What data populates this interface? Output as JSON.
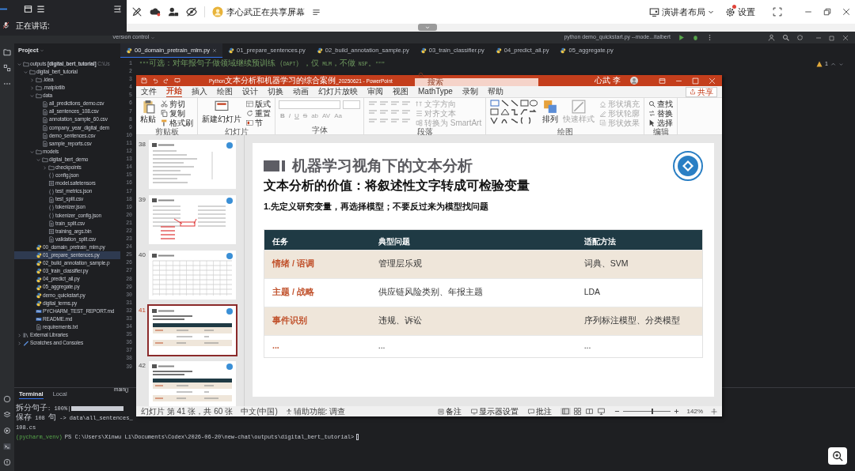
{
  "meeting": {
    "speaking_label": "正在讲话:",
    "share_status": "李心武正在共享屏幕",
    "layout_button": "演讲者布局",
    "settings_button": "设置",
    "settings_alert": true
  },
  "ide": {
    "vcs_menu": "Version control",
    "run_config": "python demo_quickstart.py --mode...italbert",
    "project_label": "Project",
    "editor_tabs": [
      {
        "label": "00_domain_pretrain_mlm.py",
        "selected": true
      },
      {
        "label": "01_prepare_sentences.py",
        "selected": false
      },
      {
        "label": "02_build_annotation_sample.py",
        "selected": false
      },
      {
        "label": "03_train_classifier.py",
        "selected": false
      },
      {
        "label": "04_predict_all.py",
        "selected": false
      },
      {
        "label": "05_aggregate.py",
        "selected": false
      }
    ],
    "tree": [
      {
        "label": "outputs **[digital_bert_tutorial]**",
        "hint": "C:\\Us",
        "kind": "folder",
        "expanded": true,
        "selected": false,
        "children": [
          {
            "label": "digital_bert_tutorial",
            "kind": "folder",
            "expanded": true,
            "selected": false,
            "children": [
              {
                "label": ".idea",
                "kind": "folder",
                "expanded": false,
                "selected": false
              },
              {
                "label": ".matplotlib",
                "kind": "folder",
                "expanded": false,
                "selected": false
              },
              {
                "label": "data",
                "kind": "folder",
                "expanded": true,
                "selected": false,
                "children": [
                  {
                    "label": "all_predictions_demo.csv",
                    "kind": "csv",
                    "selected": false
                  },
                  {
                    "label": "all_sentences_108.csv",
                    "kind": "csv",
                    "selected": false
                  },
                  {
                    "label": "annotation_sample_60.csv",
                    "kind": "csv",
                    "selected": false
                  },
                  {
                    "label": "company_year_digital_dem",
                    "kind": "csv",
                    "selected": false
                  },
                  {
                    "label": "demo_sentences.csv",
                    "kind": "csv",
                    "selected": false
                  },
                  {
                    "label": "sample_reports.csv",
                    "kind": "csv",
                    "selected": false
                  }
                ]
              },
              {
                "label": "models",
                "kind": "folder",
                "expanded": true,
                "selected": false,
                "children": [
                  {
                    "label": "digital_bert_demo",
                    "kind": "folder",
                    "expanded": true,
                    "selected": false,
                    "children": [
                      {
                        "label": "checkpoints",
                        "kind": "folder",
                        "expanded": false,
                        "selected": false
                      },
                      {
                        "label": "config.json",
                        "kind": "json",
                        "selected": false
                      },
                      {
                        "label": "model.safetensors",
                        "kind": "bin",
                        "selected": false
                      },
                      {
                        "label": "test_metrics.json",
                        "kind": "json",
                        "selected": false
                      },
                      {
                        "label": "test_split.csv",
                        "kind": "csv",
                        "selected": false
                      },
                      {
                        "label": "tokenizer.json",
                        "kind": "json",
                        "selected": false
                      },
                      {
                        "label": "tokenizer_config.json",
                        "kind": "json",
                        "selected": false
                      },
                      {
                        "label": "train_split.csv",
                        "kind": "csv",
                        "selected": false
                      },
                      {
                        "label": "training_args.bin",
                        "kind": "bin",
                        "selected": false
                      },
                      {
                        "label": "validation_split.csv",
                        "kind": "csv",
                        "selected": false
                      }
                    ]
                  }
                ]
              },
              {
                "label": "00_domain_pretrain_mlm.py",
                "kind": "py",
                "selected": false
              },
              {
                "label": "01_prepare_sentences.py",
                "kind": "py",
                "selected": true
              },
              {
                "label": "02_build_annotation_sample.p",
                "kind": "py",
                "selected": false
              },
              {
                "label": "03_train_classifier.py",
                "kind": "py",
                "selected": false
              },
              {
                "label": "04_predict_all.py",
                "kind": "py",
                "selected": false
              },
              {
                "label": "05_aggregate.py",
                "kind": "py",
                "selected": false
              },
              {
                "label": "demo_quickstart.py",
                "kind": "py",
                "selected": false
              },
              {
                "label": "digital_terms.py",
                "kind": "py",
                "selected": false
              },
              {
                "label": "PYCHARM_TEST_REPORT.md",
                "kind": "md",
                "selected": false
              },
              {
                "label": "README.md",
                "kind": "md",
                "selected": false
              },
              {
                "label": "requirements.txt",
                "kind": "txt",
                "selected": false
              }
            ]
          }
        ]
      },
      {
        "label": "External Libraries",
        "kind": "library",
        "expanded": false,
        "selected": false
      },
      {
        "label": "Scratches and Consoles",
        "kind": "scratch",
        "expanded": false,
        "selected": false
      }
    ],
    "line_numbers": [
      "1",
      "2",
      "3",
      "4",
      "5",
      "6",
      "7",
      "8",
      "9",
      "10",
      "11",
      "12",
      "13",
      "14",
      "15",
      "16",
      "17",
      "18",
      "19",
      "20",
      "21",
      "22",
      "23",
      "24",
      "25",
      "26",
      "27",
      "28",
      "29",
      "30",
      "31",
      "32",
      "33",
      "34",
      "35",
      "36",
      "37",
      "38",
      "39"
    ],
    "code_line": "\"\"\"可选：对年报句子做领域继续预训练（DAPT），仅 MLM，不做 NSP。\"\"\"",
    "warning_count": "1",
    "breadcrumb": "main()",
    "terminal": {
      "tabs": [
        {
          "label": "Terminal",
          "selected": true
        },
        {
          "label": "Local",
          "selected": false
        }
      ],
      "lines": [
        {
          "kind": "progress",
          "text": "拆分句子: 100%|",
          "level": 1
        },
        {
          "kind": "text",
          "text": "保存 108 句 -> data\\all_sentences_108.cs"
        },
        {
          "kind": "prompt",
          "venv": "(pycharm_venv)",
          "text": "PS C:\\Users\\Xinwu Li\\Documents\\Codex\\2026-06-20\\new-chat\\outputs\\digital_bert_tutorial>"
        }
      ]
    }
  },
  "powerpoint": {
    "title": "Python文本分析和机器学习的综合案例_20250621 - PowerPoint",
    "search_placeholder": "搜索",
    "user": "心武 李",
    "menu": [
      {
        "label": "文件",
        "selected": false
      },
      {
        "label": "开始",
        "selected": true
      },
      {
        "label": "插入",
        "selected": false
      },
      {
        "label": "绘图",
        "selected": false
      },
      {
        "label": "设计",
        "selected": false
      },
      {
        "label": "切换",
        "selected": false
      },
      {
        "label": "动画",
        "selected": false
      },
      {
        "label": "幻灯片放映",
        "selected": false
      },
      {
        "label": "审阅",
        "selected": false
      },
      {
        "label": "视图",
        "selected": false
      },
      {
        "label": "MathType",
        "selected": false
      },
      {
        "label": "录制",
        "selected": false
      },
      {
        "label": "帮助",
        "selected": false
      }
    ],
    "share_button": "共享",
    "ribbon": [
      {
        "label": "剪贴板",
        "kind": "standard",
        "items": [
          {
            "kind": "large",
            "label": "粘贴",
            "disabled": false
          },
          {
            "kind": "small",
            "label": "剪切",
            "disabled": false
          },
          {
            "kind": "small",
            "label": "复制",
            "disabled": false
          },
          {
            "kind": "small",
            "label": "格式刷",
            "disabled": false
          }
        ]
      },
      {
        "label": "幻灯片",
        "kind": "standard",
        "items": [
          {
            "kind": "large",
            "label": "新建幻灯片",
            "disabled": false
          },
          {
            "kind": "small",
            "label": "版式",
            "disabled": false
          },
          {
            "kind": "small",
            "label": "重置",
            "disabled": false
          },
          {
            "kind": "small",
            "label": "节",
            "disabled": false
          }
        ]
      },
      {
        "label": "字体",
        "kind": "font",
        "format_buttons": [
          "B",
          "I",
          "U",
          "S",
          "ab",
          "AV",
          "Aa"
        ],
        "disabled": true
      },
      {
        "label": "段落",
        "kind": "standard",
        "items": [
          {
            "kind": "paragraph_tools"
          },
          {
            "kind": "small",
            "label": "文字方向",
            "disabled": true
          },
          {
            "kind": "small",
            "label": "对齐文本",
            "disabled": true
          },
          {
            "kind": "small",
            "label": "转换为 SmartArt",
            "disabled": true
          }
        ]
      },
      {
        "label": "绘图",
        "kind": "standard",
        "items": [
          {
            "kind": "shapes"
          },
          {
            "kind": "large",
            "label": "排列",
            "disabled": false
          },
          {
            "kind": "large",
            "label": "快速样式",
            "disabled": true
          },
          {
            "kind": "small",
            "label": "形状填充",
            "disabled": true
          },
          {
            "kind": "small",
            "label": "形状轮廓",
            "disabled": true
          },
          {
            "kind": "small",
            "label": "形状效果",
            "disabled": true
          }
        ]
      },
      {
        "label": "编辑",
        "kind": "standard",
        "items": [
          {
            "kind": "small",
            "label": "查找",
            "disabled": false
          },
          {
            "kind": "small",
            "label": "替换",
            "disabled": false
          },
          {
            "kind": "small",
            "label": "选择",
            "disabled": false
          }
        ]
      }
    ],
    "thumbnails": [
      {
        "number": "38",
        "kind": "text",
        "selected": false
      },
      {
        "number": "39",
        "kind": "diagram",
        "selected": false
      },
      {
        "number": "40",
        "kind": "grid",
        "selected": false
      },
      {
        "number": "41",
        "kind": "table",
        "selected": true
      },
      {
        "number": "42",
        "kind": "table",
        "selected": false
      }
    ],
    "slide": {
      "title": "机器学习视角下的文本分析",
      "subtitle": "文本分析的价值：将叙述性文字转成可检验变量",
      "point": "1.先定义研究变量，再选择模型；不要反过来为模型找问题",
      "table": {
        "columns": [
          "任务",
          "典型问题",
          "适配方法"
        ],
        "rows": [
          {
            "cells": [
              "情绪 / 语调",
              "管理层乐观",
              "词典、SVM"
            ],
            "shaded": true
          },
          {
            "cells": [
              "主题 / 战略",
              "供应链风险类别、年报主题",
              "LDA"
            ],
            "shaded": false
          },
          {
            "cells": [
              "事件识别",
              "违规、诉讼",
              "序列标注模型、分类模型"
            ],
            "shaded": true
          },
          {
            "cells": [
              "...",
              "...",
              "..."
            ],
            "shaded": false
          }
        ]
      }
    },
    "status": {
      "slide_count": "幻灯片 第 41 张，共 60 张",
      "language": "中文(中国)",
      "accessibility": "辅助功能: 调查",
      "notes": "备注",
      "display": "显示器设置",
      "comments": "批注",
      "views": [
        {
          "kind": "normal",
          "selected": true
        },
        {
          "kind": "sorter",
          "selected": false
        },
        {
          "kind": "reading",
          "selected": false
        },
        {
          "kind": "slideshow",
          "selected": false
        }
      ],
      "zoom": {
        "level": 0.6,
        "reading": "142%"
      }
    }
  }
}
